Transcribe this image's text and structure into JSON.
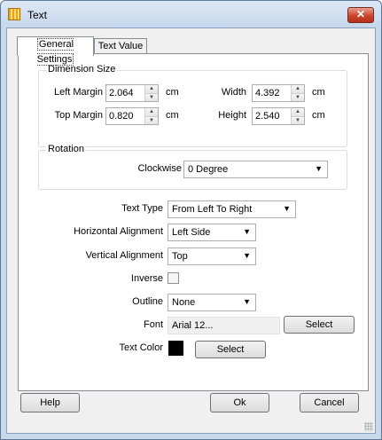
{
  "window": {
    "title": "Text",
    "close_glyph": "✕"
  },
  "tabs": [
    {
      "label": "General Settings",
      "active": true
    },
    {
      "label": "Text Value",
      "active": false
    }
  ],
  "dimension": {
    "title": "Dimension Size",
    "left_margin_label": "Left Margin",
    "left_margin_value": "2.064",
    "top_margin_label": "Top Margin",
    "top_margin_value": "0.820",
    "width_label": "Width",
    "width_value": "4.392",
    "height_label": "Height",
    "height_value": "2.540",
    "unit": "cm"
  },
  "rotation": {
    "title": "Rotation",
    "clockwise_label": "Clockwise",
    "clockwise_value": "0 Degree"
  },
  "settings": {
    "text_type_label": "Text Type",
    "text_type_value": "From Left To Right",
    "h_align_label": "Horizontal Alignment",
    "h_align_value": "Left Side",
    "v_align_label": "Vertical Alignment",
    "v_align_value": "Top",
    "inverse_label": "Inverse",
    "inverse_checked": false,
    "outline_label": "Outline",
    "outline_value": "None",
    "font_label": "Font",
    "font_value": "Arial 12...",
    "font_select": "Select",
    "text_color_label": "Text Color",
    "text_color_value": "#000000",
    "text_color_select": "Select"
  },
  "footer": {
    "help": "Help",
    "ok": "Ok",
    "cancel": "Cancel"
  },
  "icons": {
    "dropdown": "▼",
    "spin_up": "▲",
    "spin_down": "▼"
  }
}
